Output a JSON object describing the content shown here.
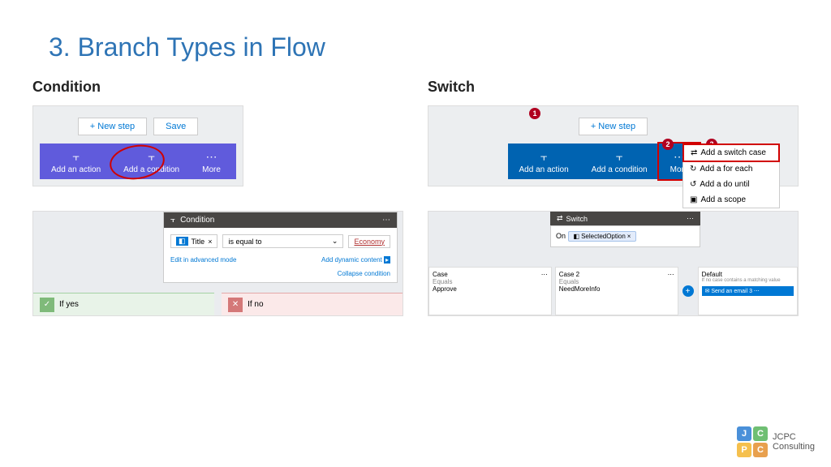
{
  "title": "3. Branch Types in Flow",
  "left": {
    "heading": "Condition",
    "newStep": "+ New step",
    "save": "Save",
    "ribbon": {
      "addAction": "Add an action",
      "addCondition": "Add a condition",
      "more": "More"
    },
    "cond": {
      "hdr": "Condition",
      "title": "Title",
      "op": "is equal to",
      "val": "Economy",
      "adv": "Edit in advanced mode",
      "dyn": "Add dynamic content",
      "collapse": "Collapse condition",
      "yes": "If yes",
      "no": "If no"
    }
  },
  "right": {
    "heading": "Switch",
    "newStep": "+ New step",
    "ribbon": {
      "addAction": "Add an action",
      "addCondition": "Add a condition",
      "more": "More"
    },
    "menu": {
      "switchCase": "Add a switch case",
      "forEach": "Add a for each",
      "doUntil": "Add a do until",
      "scope": "Add a scope"
    },
    "sw": {
      "hdr": "Switch",
      "on": "SelectedOption",
      "case1": "Case",
      "case1In": "Equals",
      "case1Val": "Approve",
      "case2": "Case 2",
      "case2In": "Equals",
      "case2Val": "NeedMoreInfo",
      "default": "Default",
      "defNote": "If no case contains a matching value",
      "action": "Send an email 3"
    }
  },
  "logo": {
    "j": "J",
    "c1": "C",
    "p": "P",
    "c2": "C",
    "line1": "JCPC",
    "line2": "Consulting"
  }
}
